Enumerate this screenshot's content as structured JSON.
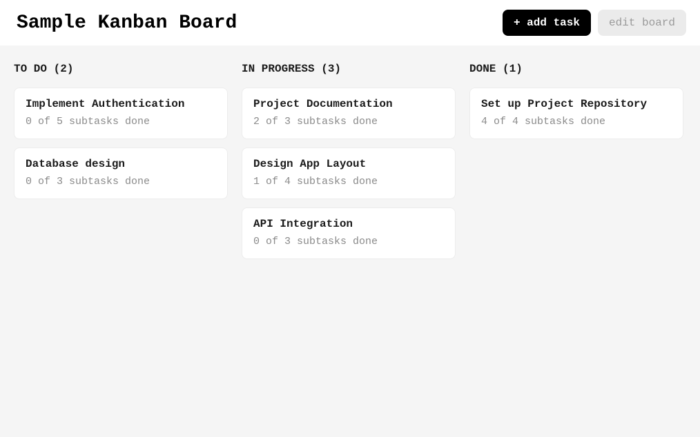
{
  "header": {
    "title": "Sample Kanban Board",
    "add_task_label": "+ add task",
    "edit_board_label": "edit board"
  },
  "columns": [
    {
      "title": "TO DO (2)",
      "cards": [
        {
          "title": "Implement Authentication",
          "sub": "0 of 5 subtasks done"
        },
        {
          "title": "Database design",
          "sub": "0 of 3 subtasks done"
        }
      ]
    },
    {
      "title": "IN PROGRESS (3)",
      "cards": [
        {
          "title": "Project Documentation",
          "sub": "2 of 3 subtasks done"
        },
        {
          "title": "Design App Layout",
          "sub": "1 of 4 subtasks done"
        },
        {
          "title": "API Integration",
          "sub": "0 of 3 subtasks done"
        }
      ]
    },
    {
      "title": "DONE (1)",
      "cards": [
        {
          "title": "Set up Project Repository",
          "sub": "4 of 4 subtasks done"
        }
      ]
    }
  ]
}
